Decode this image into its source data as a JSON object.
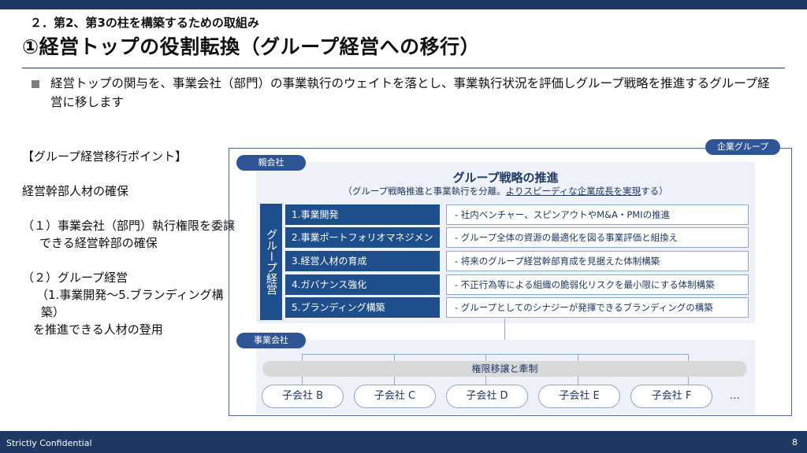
{
  "header": {
    "section": "２．第2、第3の柱を構築するための取組み",
    "title": "①経営トップの役割転換（グループ経営への移行）"
  },
  "bullet": "経営トップの関与を、事業会社（部門）の事業執行のウェイトを落とし、事業執行状況を評価しグループ戦略を推進するグループ経営に移します",
  "points": {
    "heading": "【グループ経営移行ポイント】",
    "line1": "経営幹部人材の確保",
    "item1": "（１）事業会社（部門）執行権限を委譲できる経営幹部の確保",
    "item2a": "（２）グループ経営",
    "item2b": "（1.事業開発～5.ブランディング構築）",
    "item2c": "を推進できる人材の登用"
  },
  "diagram": {
    "group_label": "企業グループ",
    "parent_label": "親会社",
    "strategy_title": "グループ戦略の推進",
    "strategy_sub_pre": "（グループ戦略推進と事業執行を分離。",
    "strategy_sub_underline": "よりスピーディな企業成長を実現",
    "strategy_sub_post": "する）",
    "vertical_label": "グループ経営",
    "items": [
      {
        "label": "1.事業開発",
        "desc": "-  社内ベンチャー、スピンアウトやM&A・PMIの推進"
      },
      {
        "label": "2.事業ポートフォリオマネジメント",
        "desc": "-  グループ全体の資源の最適化を図る事業評価と組換え"
      },
      {
        "label": "3.経営人材の育成",
        "desc": "-  将来のグループ経営幹部育成を見据えた体制構築"
      },
      {
        "label": "4.ガバナンス強化",
        "desc": "-  不正行為等による組織の脆弱化リスクを最小限にする体制構築"
      },
      {
        "label": "5.ブランディング構築",
        "desc": "-  グループとしてのシナジーが発揮できるブランディングの構築"
      }
    ],
    "business_label": "事業会社",
    "authority_label": "権限移譲と牽制",
    "subsidiaries": [
      "子会社 B",
      "子会社 C",
      "子会社 D",
      "子会社 E",
      "子会社 F"
    ],
    "ellipsis": "…"
  },
  "footer": {
    "confidential": "Strictly Confidential",
    "page": "8"
  }
}
